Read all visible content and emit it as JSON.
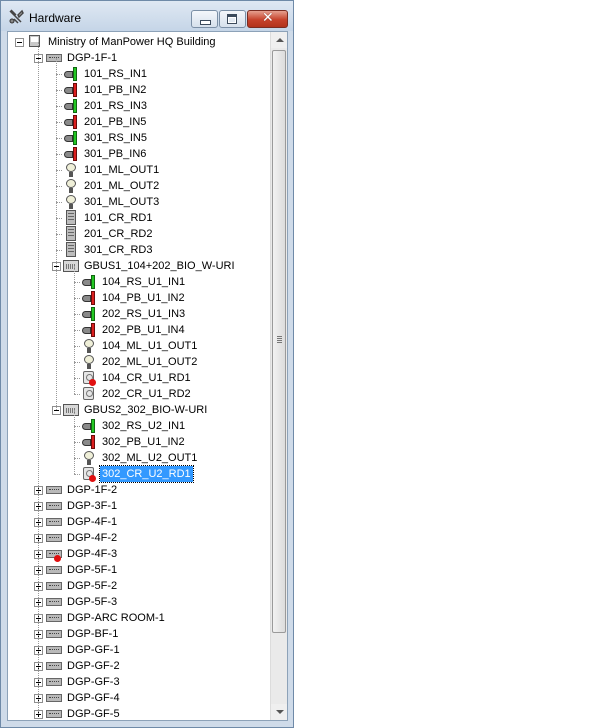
{
  "window": {
    "title": "Hardware",
    "icons": {
      "app": "hardware-icon",
      "minimize": "minimize-icon",
      "maximize": "maximize-icon",
      "close": "close-icon"
    },
    "close_glyph": "✕"
  },
  "tree": {
    "root": {
      "label": "Ministry of ManPower HQ Building",
      "icon": "building-pc-icon",
      "expanded": true
    },
    "panel_1f1": {
      "label": "DGP-1F-1",
      "icon": "panel-module-icon",
      "expanded": true,
      "children": [
        {
          "label": "101_RS_IN1",
          "icon": "input-green-icon"
        },
        {
          "label": "101_PB_IN2",
          "icon": "input-red-icon"
        },
        {
          "label": "201_RS_IN3",
          "icon": "input-green-icon"
        },
        {
          "label": "201_PB_IN5",
          "icon": "input-red-icon"
        },
        {
          "label": "301_RS_IN5",
          "icon": "input-green-icon"
        },
        {
          "label": "301_PB_IN6",
          "icon": "input-red-icon"
        },
        {
          "label": "101_ML_OUT1",
          "icon": "lightbulb-output-icon"
        },
        {
          "label": "201_ML_OUT2",
          "icon": "lightbulb-output-icon"
        },
        {
          "label": "301_ML_OUT3",
          "icon": "lightbulb-output-icon"
        },
        {
          "label": "101_CR_RD1",
          "icon": "card-reader-icon"
        },
        {
          "label": "201_CR_RD2",
          "icon": "card-reader-icon"
        },
        {
          "label": "301_CR_RD3",
          "icon": "card-reader-icon"
        }
      ],
      "gbus1": {
        "label": "GBUS1_104+202_BIO_W-URI",
        "icon": "gbus-module-icon",
        "children": [
          {
            "label": "104_RS_U1_IN1",
            "icon": "input-green-icon"
          },
          {
            "label": "104_PB_U1_IN2",
            "icon": "input-red-icon"
          },
          {
            "label": "202_RS_U1_IN3",
            "icon": "input-green-icon"
          },
          {
            "label": "202_PB_U1_IN4",
            "icon": "input-red-icon"
          },
          {
            "label": "104_ML_U1_OUT1",
            "icon": "lightbulb-output-icon"
          },
          {
            "label": "202_ML_U1_OUT2",
            "icon": "lightbulb-output-icon"
          },
          {
            "label": "104_CR_U1_RD1",
            "icon": "card-reader-alarm-icon"
          },
          {
            "label": "202_CR_U1_RD2",
            "icon": "card-reader-unit-icon"
          }
        ]
      },
      "gbus2": {
        "label": "GBUS2_302_BIO-W-URI",
        "icon": "gbus-module-icon",
        "children": [
          {
            "label": "302_RS_U2_IN1",
            "icon": "input-green-icon"
          },
          {
            "label": "302_PB_U1_IN2",
            "icon": "input-red-icon"
          },
          {
            "label": "302_ML_U2_OUT1",
            "icon": "lightbulb-output-icon"
          },
          {
            "label": "302_CR_U2_RD1",
            "icon": "card-reader-alarm-icon",
            "selected": true
          }
        ]
      }
    },
    "collapsed_panels": [
      {
        "label": "DGP-1F-2",
        "alarm": false
      },
      {
        "label": "DGP-3F-1",
        "alarm": false
      },
      {
        "label": "DGP-4F-1",
        "alarm": false
      },
      {
        "label": "DGP-4F-2",
        "alarm": false
      },
      {
        "label": "DGP-4F-3",
        "alarm": true
      },
      {
        "label": "DGP-5F-1",
        "alarm": false
      },
      {
        "label": "DGP-5F-2",
        "alarm": false
      },
      {
        "label": "DGP-5F-3",
        "alarm": false
      },
      {
        "label": "DGP-ARC ROOM-1",
        "alarm": false
      },
      {
        "label": "DGP-BF-1",
        "alarm": false
      },
      {
        "label": "DGP-GF-1",
        "alarm": false
      },
      {
        "label": "DGP-GF-2",
        "alarm": false
      },
      {
        "label": "DGP-GF-3",
        "alarm": false
      },
      {
        "label": "DGP-GF-4",
        "alarm": false
      },
      {
        "label": "DGP-GF-5",
        "alarm": false
      }
    ]
  },
  "scrollbar": {
    "icons": {
      "up": "scroll-up-arrow-icon",
      "down": "scroll-down-arrow-icon"
    }
  }
}
